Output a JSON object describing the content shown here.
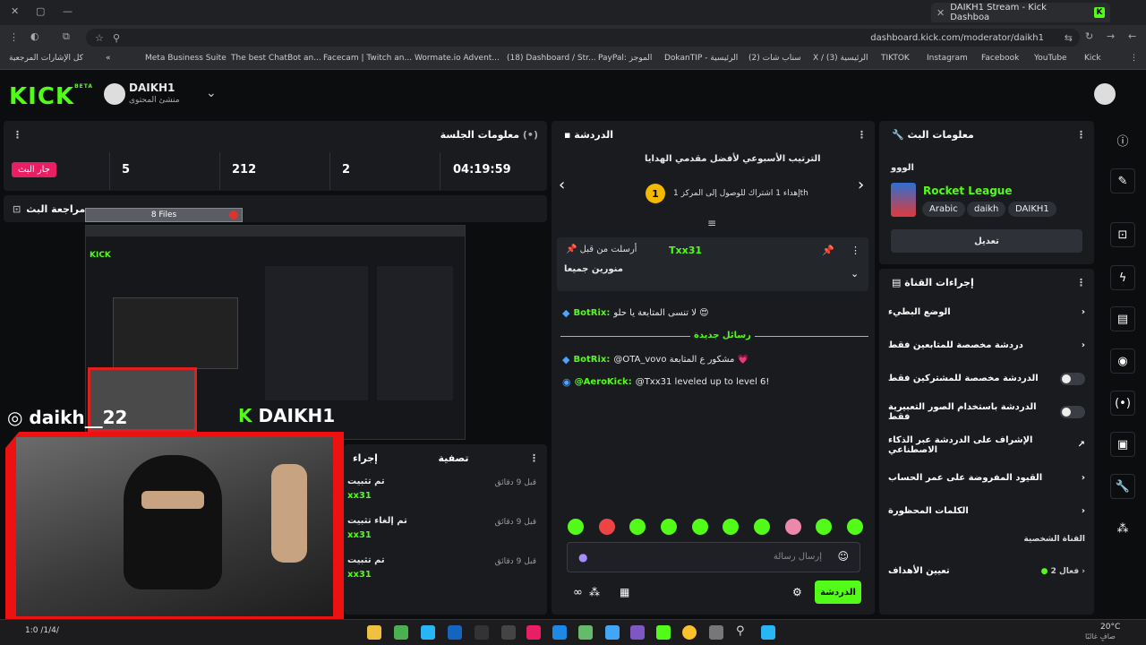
{
  "browser": {
    "tab_title": "DAIKH1 Stream - Kick Dashboa",
    "url": "dashboard.kick.com/moderator/daikh1",
    "bookmarks": [
      "كل الإشارات المرجعية",
      "Meta Business Suite",
      "The best ChatBot an...",
      "Facecam | Twitch an...",
      "Wormate.io Advent...",
      "(18) Dashboard / Str...",
      "PayPal: الموجز",
      "DokanTIP - الرئيسية",
      "(2) سناب شات",
      "X / الرئيسية (3)",
      "TIKTOK",
      "Instagram",
      "Facebook",
      "YouTube",
      "Kick"
    ]
  },
  "header": {
    "logo": "KICK",
    "beta": "BETA",
    "channel": "DAIKH1",
    "role": "منشئ المحتوى"
  },
  "session": {
    "title": "معلومات الجلسة",
    "live_badge": "جار البث",
    "stats": [
      "5",
      "212",
      "2",
      "04:19:59"
    ]
  },
  "preview": {
    "title": "مراجعة البث",
    "files": "8 Files",
    "overlay_name": "daikh__22",
    "overlay_channel": "DAIKH1"
  },
  "mod_panel": {
    "filter": "تصفية",
    "actions": "إجراء",
    "items": [
      {
        "label": "تم تثبيت",
        "user": "xx31",
        "time": "قبل 9 دقائق"
      },
      {
        "label": "تم إلغاء تثبيت",
        "user": "xx31",
        "time": "قبل 9 دقائق"
      },
      {
        "label": "تم تثبيت",
        "user": "xx31",
        "time": "قبل 9 دقائق"
      }
    ]
  },
  "chat": {
    "title": "الدردشة",
    "leaderboard_title": "الترتيب الأسبوعي لأفضل مقدمي الهدايا",
    "leaderboard_rank": "1",
    "leaderboard_text": "إهداء 1 اشتراك للوصول إلى المركز 1th",
    "pinned_by": "أرسلت من قبل",
    "pinned_user": "Txx31",
    "pinned_msg": "منورين جميعا",
    "messages": [
      {
        "user": "BotRix:",
        "text": "لا تنسى المتابعة يا حلو 😍"
      },
      {
        "user": "BotRix:",
        "text": "@OTA_vovo مشكور ع المتابعة 💗"
      },
      {
        "user": "@AeroKick:",
        "text": "@Txx31 leveled up to level 6!"
      }
    ],
    "new_messages": "رسائل جديدة",
    "input_placeholder": "إرسال رسالة",
    "send_button": "الدردشة"
  },
  "stream_info": {
    "title": "معلومات البث",
    "stream_title": "الووو",
    "category": "Rocket League",
    "tags": [
      "Arabic",
      "daikh",
      "DAIKH1"
    ],
    "edit_button": "تعديل"
  },
  "channel_actions": {
    "title": "إجراءات القناة",
    "items": [
      {
        "label": "الوضع البطيء",
        "control": "chevron"
      },
      {
        "label": "دردشة مخصصة للمتابعين فقط",
        "control": "chevron"
      },
      {
        "label": "الدردشة مخصصة للمشتركين فقط",
        "control": "toggle"
      },
      {
        "label": "الدردشة باستخدام الصور التعبيرية فقط",
        "control": "toggle"
      },
      {
        "label": "الإشراف على الدردشة عبر الذكاء الاصطناعي",
        "control": "link"
      },
      {
        "label": "القيود المفروضة على عمر الحساب",
        "control": "chevron"
      },
      {
        "label": "الكلمات المحظورة",
        "control": "chevron"
      }
    ],
    "section": "القناة الشخصية",
    "goal_label": "تعيين الأهداف",
    "goal_status": "فعال 2"
  },
  "taskbar": {
    "weather_temp": "20°C",
    "weather_text": "صافٍ غالبًا",
    "time": "1:0 /1/4/"
  }
}
